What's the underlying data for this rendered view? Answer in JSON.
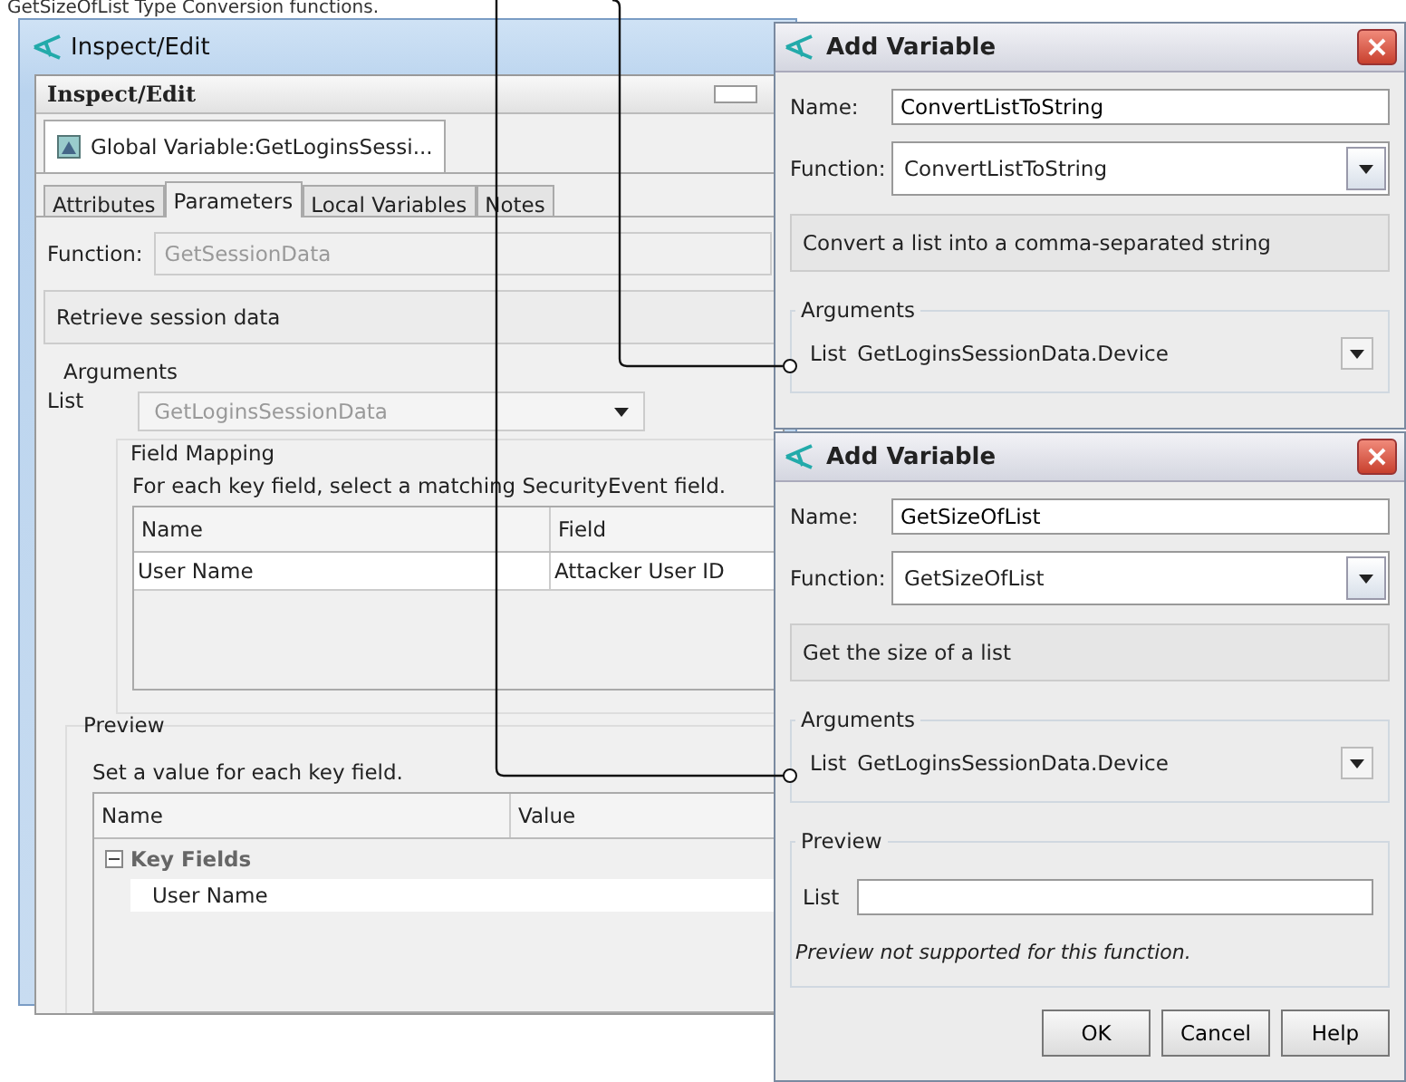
{
  "caption": "GetSizeOfList Type Conversion functions.",
  "main_window": {
    "title": "Inspect/Edit",
    "panel_title": "Inspect/Edit",
    "editor_tab": "Global Variable:GetLoginsSessi...",
    "tabs": [
      {
        "label": "Attributes",
        "selected": false
      },
      {
        "label": "Parameters",
        "selected": true
      },
      {
        "label": "Local Variables",
        "selected": false
      },
      {
        "label": "Notes",
        "selected": false
      }
    ],
    "function_label": "Function:",
    "function_value": "GetSessionData",
    "description": "Retrieve session data",
    "arguments": {
      "legend": "Arguments",
      "list_label": "List",
      "list_value": "GetLoginsSessionData"
    },
    "field_mapping": {
      "legend": "Field Mapping",
      "hint": "For each key field, select a matching SecurityEvent field.",
      "columns": [
        "Name",
        "Field"
      ],
      "rows": [
        [
          "User Name",
          "Attacker User ID"
        ]
      ]
    },
    "preview": {
      "legend": "Preview",
      "hint": "Set a value for each key field.",
      "columns": [
        "Name",
        "Value"
      ],
      "groups": [
        {
          "label": "Key Fields",
          "expanded": true,
          "children": [
            "User Name"
          ]
        }
      ]
    }
  },
  "dialogs": [
    {
      "title": "Add Variable",
      "name_label": "Name:",
      "name_value": "ConvertListToString",
      "function_label": "Function:",
      "function_value": "ConvertListToString",
      "description": "Convert a list into a comma-separated string",
      "arguments_legend": "Arguments",
      "list_label": "List",
      "list_value": "GetLoginsSessionData.Device"
    },
    {
      "title": "Add Variable",
      "name_label": "Name:",
      "name_value": "GetSizeOfList",
      "function_label": "Function:",
      "function_value": "GetSizeOfList",
      "description": "Get the size of a list",
      "arguments_legend": "Arguments",
      "list_label": "List",
      "list_value": "GetLoginsSessionData.Device",
      "preview": {
        "legend": "Preview",
        "list_label": "List",
        "note": "Preview not supported for this function."
      },
      "buttons": [
        "OK",
        "Cancel",
        "Help"
      ]
    }
  ]
}
